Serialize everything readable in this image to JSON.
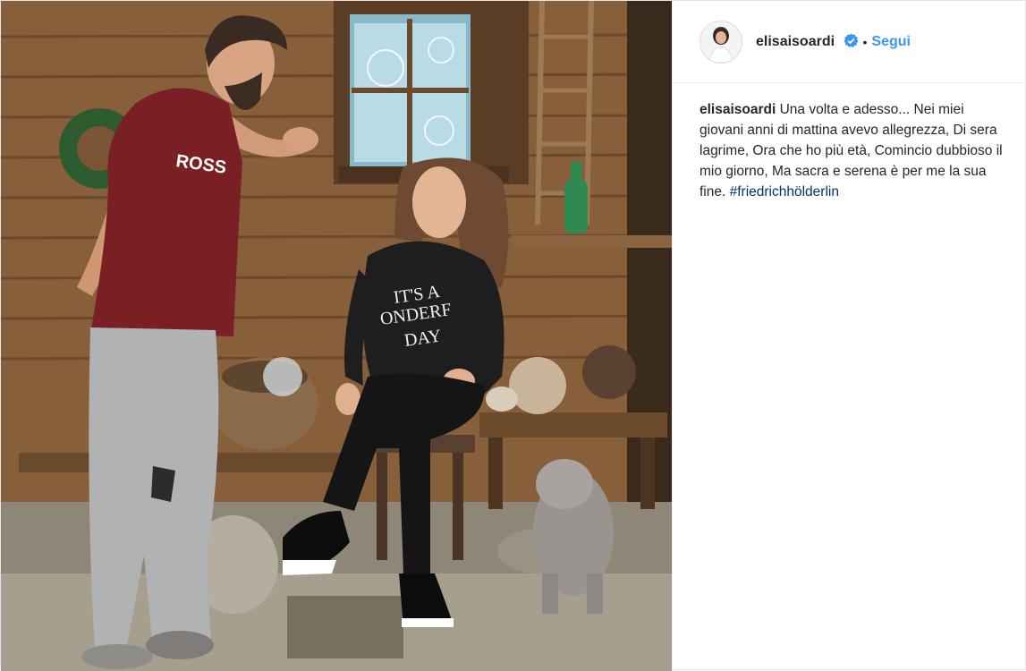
{
  "header": {
    "username": "elisaisoardi",
    "separator": "•",
    "follow_label": "Segui"
  },
  "caption": {
    "username": "elisaisoardi",
    "text": "Una volta e adesso... Nei miei giovani anni di mattina avevo allegrezza, Di sera lagrime, Ora che ho più età, Comincio dubbioso il mio giorno, Ma sacra e serena è per me la sua fine. ",
    "hashtag": "#friedrichhölderlin"
  },
  "photo": {
    "sweatshirt_text_line1": "IT'S A",
    "sweatshirt_text_line2": "ONDERF",
    "sweatshirt_text_line3": "DAY"
  },
  "colors": {
    "follow": "#3897f0",
    "hashtag": "#003569",
    "verified": "#3897f0"
  },
  "icons": {
    "verified": "verified-badge-icon"
  }
}
